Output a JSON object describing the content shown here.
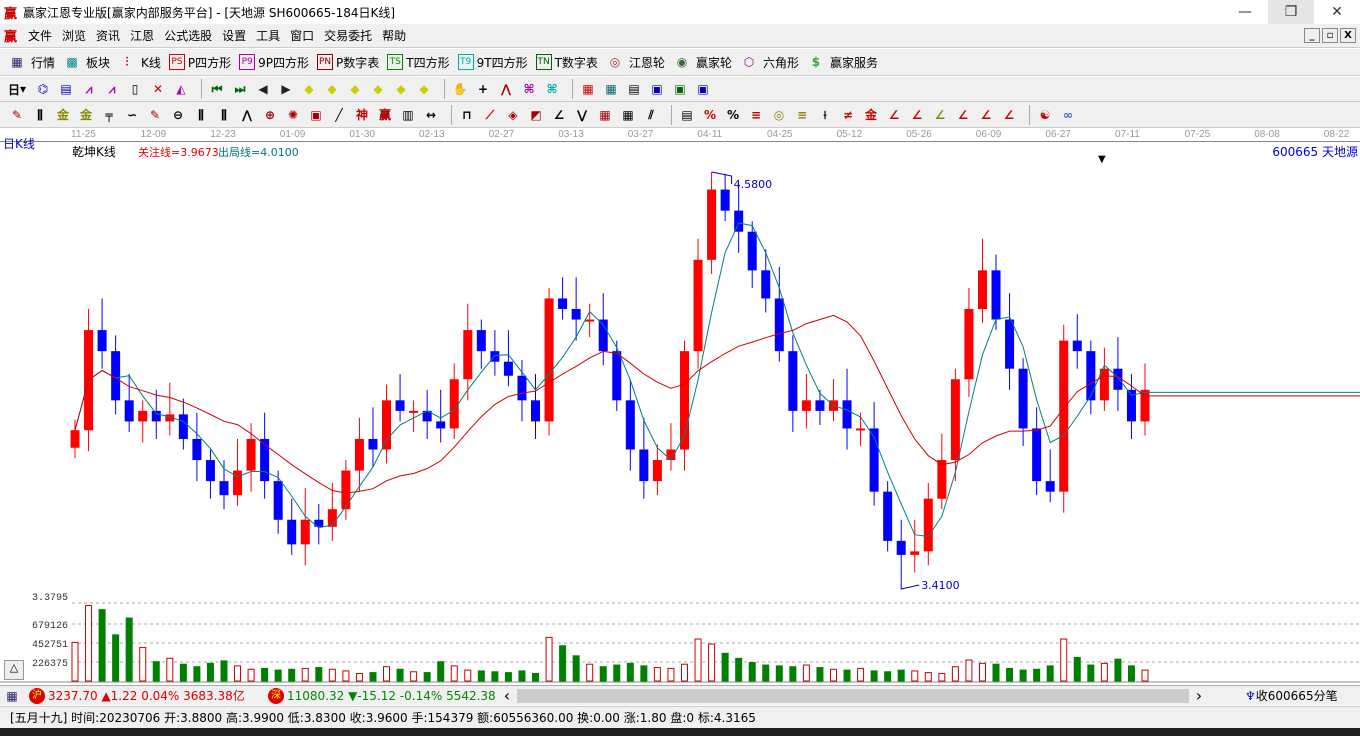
{
  "window": {
    "title": "赢家江恩专业版[赢家内部服务平台] - [天地源  SH600665-184日K线]",
    "logo": "赢",
    "minimize": "—",
    "restore": "❐",
    "close": "✕"
  },
  "menu": [
    "文件",
    "浏览",
    "资讯",
    "江恩",
    "公式选股",
    "设置",
    "工具",
    "窗口",
    "交易委托",
    "帮助"
  ],
  "toolbar1": [
    {
      "icon": "PS",
      "label": "P四方形",
      "color": "#c00"
    },
    {
      "icon": "P9",
      "label": "9P四方形",
      "color": "#a0a"
    },
    {
      "icon": "PN",
      "label": "P数字表",
      "color": "#800"
    },
    {
      "icon": "TS",
      "label": "T四方形",
      "color": "#080"
    },
    {
      "icon": "T9",
      "label": "9T四方形",
      "color": "#0aa"
    },
    {
      "icon": "TN",
      "label": "T数字表",
      "color": "#060"
    }
  ],
  "toolbar1_main": {
    "quotes": "行情",
    "sectors": "板块",
    "kline": "K线",
    "gann_wheel": "江恩轮",
    "winner_wheel": "赢家轮",
    "hexagon": "六角形",
    "service": "赢家服务"
  },
  "period_selector": "日",
  "date_axis": [
    "11-25",
    "12-09",
    "12-23",
    "01-09",
    "01-30",
    "02-13",
    "02-27",
    "03-13",
    "03-27",
    "04-11",
    "04-25",
    "05-12",
    "05-26",
    "06-09",
    "06-27",
    "07-11",
    "07-25",
    "08-08",
    "08-22"
  ],
  "chart_header": {
    "period": "日K线",
    "indicator": "乾坤K线",
    "focus_line": "关注线=3.9673",
    "exit_line": "出局线=4.0100",
    "stock": "600665 天地源"
  },
  "chart_data": {
    "type": "candlestick",
    "high_label": "4.5800",
    "low_label": "3.4100",
    "high": 4.58,
    "low": 3.41,
    "close": [
      3.845,
      4.13,
      4.07,
      3.93,
      3.87,
      3.9,
      3.87,
      3.89,
      3.82,
      3.76,
      3.7,
      3.66,
      3.73,
      3.82,
      3.7,
      3.59,
      3.52,
      3.59,
      3.57,
      3.62,
      3.73,
      3.82,
      3.79,
      3.93,
      3.9,
      3.9,
      3.87,
      3.85,
      3.99,
      4.13,
      4.07,
      4.04,
      4.0,
      3.93,
      3.87,
      4.22,
      4.19,
      4.16,
      4.16,
      4.07,
      3.93,
      3.79,
      3.7,
      3.76,
      3.79,
      4.07,
      4.33,
      4.53,
      4.47,
      4.41,
      4.3,
      4.22,
      4.07,
      3.9,
      3.93,
      3.9,
      3.93,
      3.85,
      3.85,
      3.67,
      3.53,
      3.49,
      3.5,
      3.65,
      3.76,
      3.99,
      4.19,
      4.3,
      4.16,
      4.02,
      3.85,
      3.7,
      3.67,
      4.1,
      4.07,
      3.93,
      4.02,
      3.96,
      3.87,
      3.96
    ],
    "volume": [
      460000,
      900000,
      850000,
      550000,
      750000,
      400000,
      230000,
      270000,
      200000,
      170000,
      210000,
      240000,
      180000,
      140000,
      150000,
      130000,
      140000,
      150000,
      160000,
      140000,
      120000,
      90000,
      100000,
      170000,
      140000,
      110000,
      100000,
      230000,
      180000,
      130000,
      120000,
      110000,
      100000,
      120000,
      90000,
      520000,
      420000,
      300000,
      200000,
      170000,
      190000,
      210000,
      180000,
      160000,
      150000,
      200000,
      500000,
      440000,
      330000,
      270000,
      220000,
      190000,
      180000,
      170000,
      190000,
      160000,
      140000,
      130000,
      150000,
      120000,
      110000,
      130000,
      120000,
      100000,
      90000,
      170000,
      250000,
      210000,
      200000,
      150000,
      130000,
      140000,
      180000,
      500000,
      280000,
      190000,
      210000,
      260000,
      180000,
      130000
    ],
    "volume_ticks": [
      "226375",
      "452751",
      "679126"
    ],
    "price_label": "3.3795",
    "colors": {
      "up": "#ff0000",
      "down": "#0000ff",
      "ma_short": "#008080",
      "ma_long": "#d00000",
      "vol_up": "#cc0000",
      "vol_down": "#008000"
    }
  },
  "ticker": {
    "sh_badge": "沪",
    "sh_text": "3237.70 ▲1.22 0.04% 3683.38亿",
    "sz_badge": "深",
    "sz_text": "11080.32 ▼-15.12 -0.14% 5542.38",
    "scroll_left": "‹",
    "scroll_right": "›",
    "tick_label": "收600665分笔"
  },
  "status": "[五月十九] 时间:20230706 开:3.8800 高:3.9900 低:3.8300 收:3.9600 手:154379 额:60556360.00 换:0.00 涨:1.80 盘:0 标:4.3165"
}
